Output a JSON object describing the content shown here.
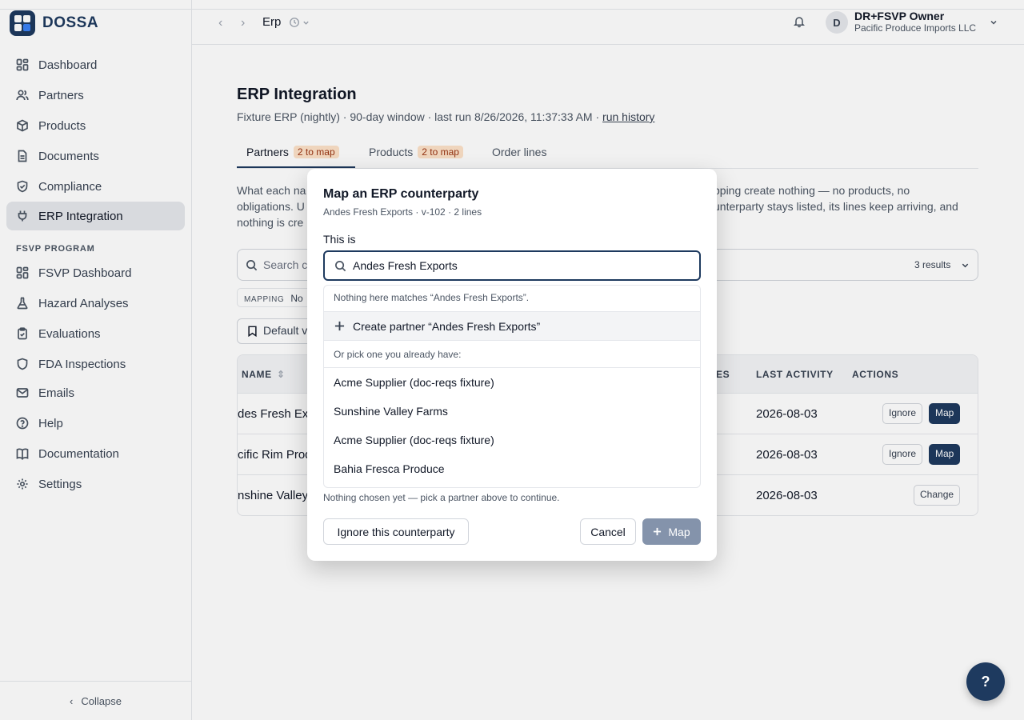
{
  "brand": {
    "name": "DOSSA"
  },
  "sidebar": {
    "items": [
      {
        "label": "Dashboard",
        "icon": "dashboard-icon"
      },
      {
        "label": "Partners",
        "icon": "users-icon"
      },
      {
        "label": "Products",
        "icon": "box-icon"
      },
      {
        "label": "Documents",
        "icon": "document-icon"
      },
      {
        "label": "Compliance",
        "icon": "shield-check-icon"
      },
      {
        "label": "ERP Integration",
        "icon": "plug-icon"
      }
    ],
    "section_label": "FSVP PROGRAM",
    "fsvp_items": [
      {
        "label": "FSVP Dashboard",
        "icon": "dashboard-icon"
      },
      {
        "label": "Hazard Analyses",
        "icon": "flask-icon"
      },
      {
        "label": "Evaluations",
        "icon": "clipboard-icon"
      },
      {
        "label": "FDA Inspections",
        "icon": "shield-icon"
      },
      {
        "label": "Emails",
        "icon": "mail-icon"
      },
      {
        "label": "Help",
        "icon": "help-circle-icon"
      },
      {
        "label": "Documentation",
        "icon": "book-icon"
      },
      {
        "label": "Settings",
        "icon": "gear-icon"
      }
    ],
    "collapse_label": "Collapse"
  },
  "header": {
    "breadcrumb": "Erp",
    "user": {
      "initial": "D",
      "name": "DR+FSVP Owner",
      "org": "Pacific Produce Imports LLC"
    }
  },
  "page": {
    "title": "ERP Integration",
    "subtitle": "Fixture ERP (nightly) · 90-day window · last run 8/26/2026, 11:37:33 AM · ",
    "run_history": "run history",
    "tabs": [
      {
        "label": "Partners",
        "badge": "2 to map"
      },
      {
        "label": "Products",
        "badge": "2 to map"
      },
      {
        "label": "Order lines"
      }
    ],
    "desc_line1_left": "What each na",
    "desc_line1_right": "pping create nothing — no products, no",
    "desc_line2_left": "obligations. U",
    "desc_line2_right": "unterparty stays listed, its lines keep arriving, and",
    "desc_line3_left": "nothing is cre",
    "search_placeholder": "Search c",
    "results": "3 results",
    "mapping_label": "MAPPING",
    "mapping_value": "No",
    "default_view": "Default v",
    "table": {
      "col_name": "NAME",
      "col_es": "ES",
      "col_last_activity": "LAST ACTIVITY",
      "col_actions": "ACTIONS",
      "rows": [
        {
          "name": "des Fresh Exp",
          "last_activity": "2026-08-03",
          "actions": [
            "Ignore",
            "Map"
          ]
        },
        {
          "name": "cific Rim Produ",
          "last_activity": "2026-08-03",
          "actions": [
            "Ignore",
            "Map"
          ]
        },
        {
          "name": "nshine Valley F",
          "last_activity": "2026-08-03",
          "actions": [
            "Change"
          ]
        }
      ]
    }
  },
  "modal": {
    "title": "Map an ERP counterparty",
    "subtitle": "Andes Fresh Exports · v-102 · 2 lines",
    "field_label": "This is",
    "input_value": "Andes Fresh Exports",
    "no_match": "Nothing here matches “Andes Fresh Exports”.",
    "create_label": "Create partner “Andes Fresh Exports”",
    "pick_label": "Or pick one you already have:",
    "options": [
      "Acme Supplier (doc-reqs fixture)",
      "Sunshine Valley Farms",
      "Acme Supplier (doc-reqs fixture)",
      "Bahia Fresca Produce"
    ],
    "hint": "Nothing chosen yet — pick a partner above to continue.",
    "ignore_button": "Ignore this counterparty",
    "cancel_button": "Cancel",
    "map_button": "Map"
  },
  "fab": {
    "label": "?"
  },
  "colors": {
    "brand": "#1e3a5f",
    "badge_bg": "#fde2c8",
    "map_disabled": "#8493ab"
  }
}
